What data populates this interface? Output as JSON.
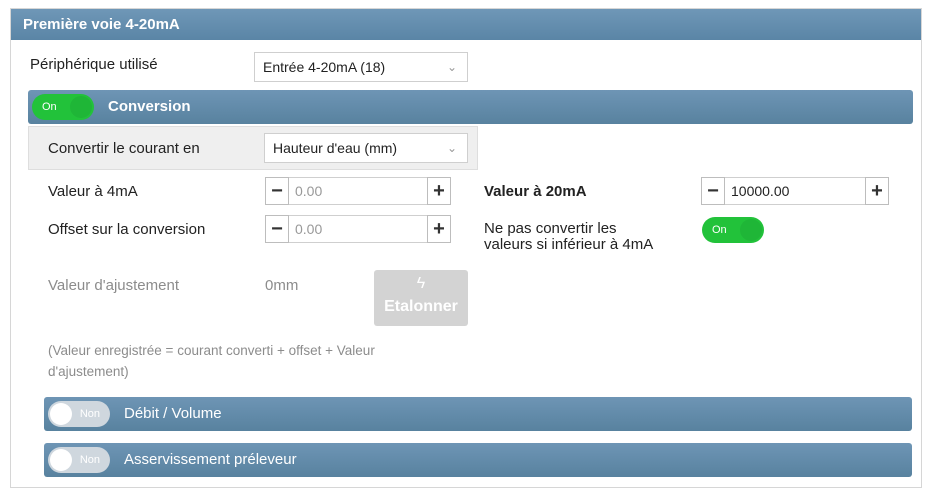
{
  "panel": {
    "title": "Première voie 4-20mA"
  },
  "peripheral": {
    "label": "Périphérique utilisé",
    "value": "Entrée 4-20mA (18)"
  },
  "conversion": {
    "toggle": "On",
    "title": "Conversion",
    "convert_label": "Convertir le courant en",
    "convert_value": "Hauteur d'eau (mm)",
    "v4_label": "Valeur à 4mA",
    "v4_value": "0.00",
    "offset_label": "Offset sur la conversion",
    "offset_value": "0.00",
    "v20_label": "Valeur à 20mA",
    "v20_value": "10000.00",
    "noconv_line1": "Ne pas convertir les",
    "noconv_line2": "valeurs si inférieur à 4mA",
    "noconv_toggle": "On",
    "adjust_label": "Valeur d'ajustement",
    "adjust_value": "0mm",
    "calibrate_label": "Etalonner",
    "note_line1": "(Valeur enregistrée = courant converti + offset + Valeur",
    "note_line2": "d'ajustement)"
  },
  "debit": {
    "toggle": "Non",
    "title": "Débit / Volume"
  },
  "preleveur": {
    "toggle": "Non",
    "title": "Asservissement préleveur"
  },
  "icons": {
    "minus": "−",
    "plus": "+",
    "caret": "⌄",
    "bolt": "⚡"
  }
}
